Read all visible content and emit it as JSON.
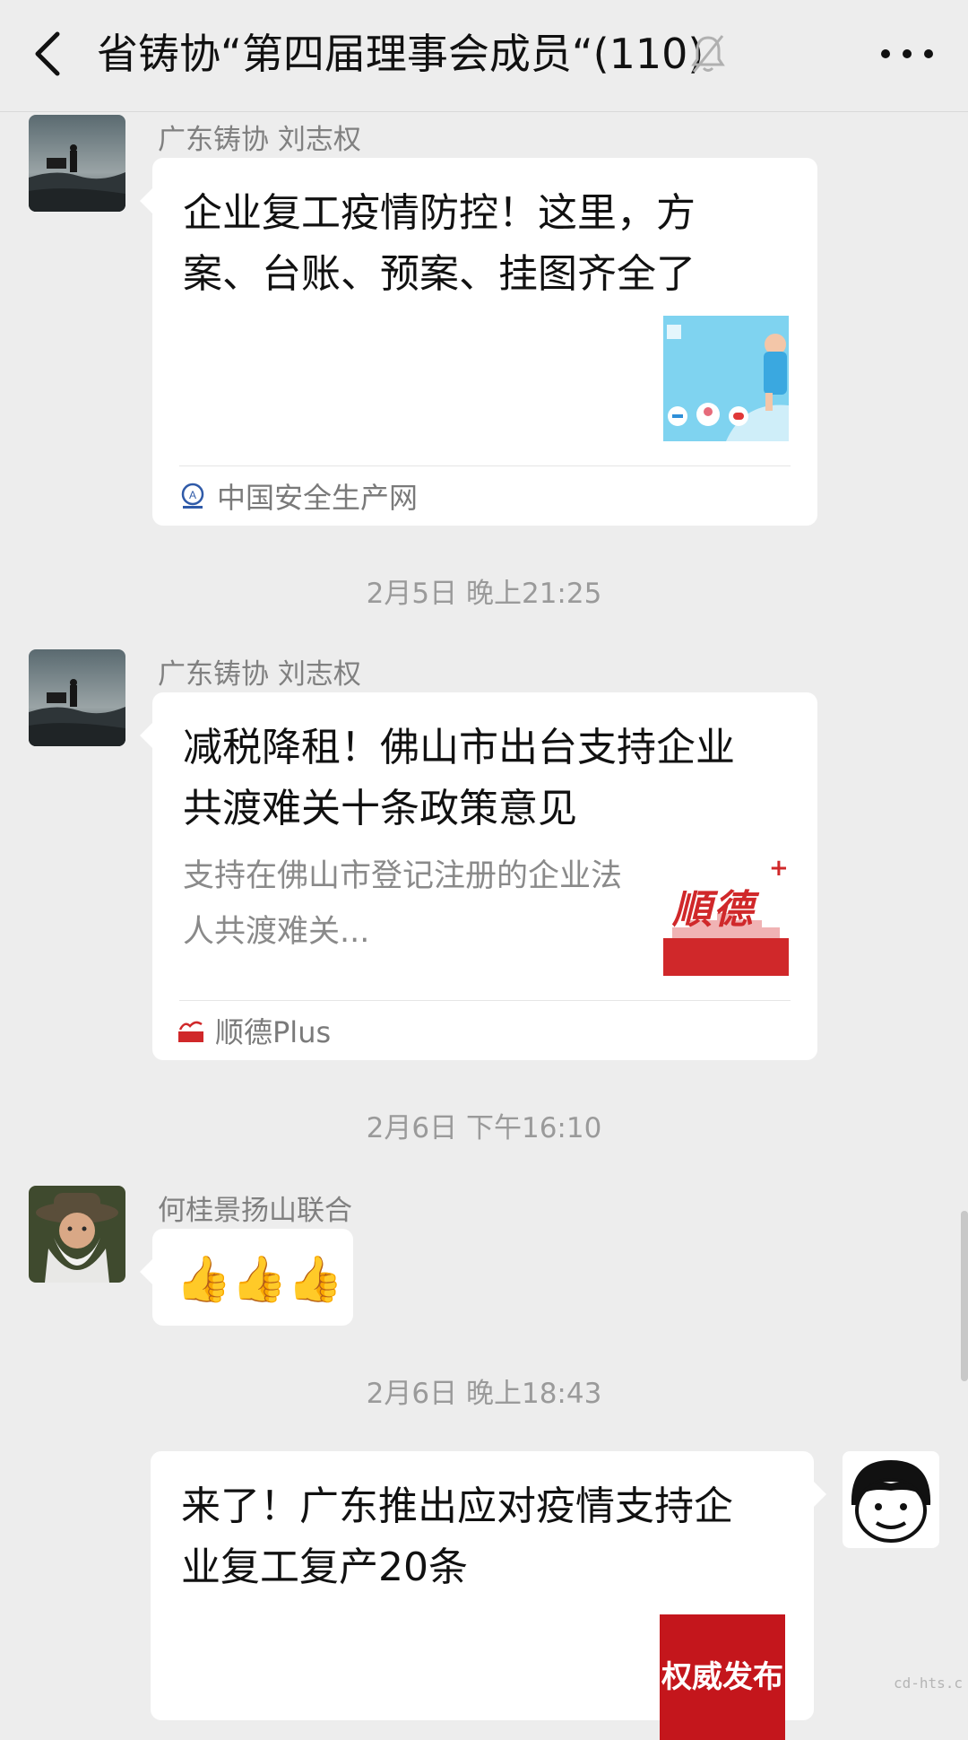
{
  "header": {
    "title": "省铸协“第四届理事会成员“(110)"
  },
  "messages": [
    {
      "sender": "广东铸协  刘志权",
      "title": "企业复工疫情防控！这里，方案、台账、预案、挂图齐全了",
      "source": "中国安全生产网"
    },
    {
      "timestamp": "2月5日 晚上21:25",
      "sender": "广东铸协  刘志权",
      "title": "减税降租！佛山市出台支持企业共渡难关十条政策意见",
      "description": "支持在佛山市登记注册的企业法人共渡难关...",
      "thumb_text": "順德",
      "source": "顺德Plus"
    },
    {
      "timestamp": "2月6日 下午16:10",
      "sender": "何桂景扬山联合",
      "content": "👍👍👍"
    },
    {
      "timestamp": "2月6日 晚上18:43",
      "title": "来了！广东推出应对疫情支持企业复工复产20条",
      "thumb_text": "权威发布"
    }
  ],
  "watermark": "cd-hts.c",
  "colors": {
    "background": "#ededed",
    "bubble": "#ffffff",
    "red_brand": "#d0282a",
    "blue_thumb": "#7fd3f0"
  }
}
